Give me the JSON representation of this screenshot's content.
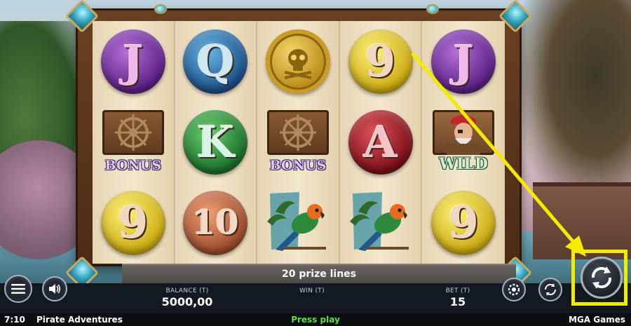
{
  "game": {
    "title": "Pirate Adventures",
    "provider": "MGA Games",
    "clock": "7:10",
    "status_message": "Press play"
  },
  "reels": [
    [
      {
        "type": "letter",
        "glyph": "J",
        "color": "purple"
      },
      {
        "type": "bonus",
        "label": "BONUS",
        "icon": "ship-wheel-icon"
      },
      {
        "type": "letter",
        "glyph": "9",
        "color": "yellow"
      }
    ],
    [
      {
        "type": "letter",
        "glyph": "Q",
        "color": "blue"
      },
      {
        "type": "letter",
        "glyph": "K",
        "color": "green"
      },
      {
        "type": "letter",
        "glyph": "10",
        "color": "copper"
      }
    ],
    [
      {
        "type": "skull-coin",
        "icon": "skull-coin-icon"
      },
      {
        "type": "bonus",
        "label": "BONUS",
        "icon": "ship-wheel-icon"
      },
      {
        "type": "parrot",
        "icon": "parrot-icon"
      }
    ],
    [
      {
        "type": "letter",
        "glyph": "9",
        "color": "yellow"
      },
      {
        "type": "letter",
        "glyph": "A",
        "color": "red"
      },
      {
        "type": "parrot",
        "icon": "parrot-icon"
      }
    ],
    [
      {
        "type": "letter",
        "glyph": "J",
        "color": "purple"
      },
      {
        "type": "wild",
        "label": "WILD",
        "icon": "pirate-captain-icon"
      },
      {
        "type": "letter",
        "glyph": "9",
        "color": "yellow"
      }
    ]
  ],
  "prize_lines": "20 prize lines",
  "stats": {
    "balance_label": "BALANCE (T)",
    "balance_value": "5000,00",
    "win_label": "WIN (T)",
    "bet_label": "BET (T)",
    "bet_value": "15"
  },
  "buttons": {
    "menu": "menu-icon",
    "sound": "speaker-icon",
    "autoplay": "autoplay-icon",
    "turbo": "turbo-icon",
    "spin": "spin-icon"
  },
  "highlight_color": "#f4ea00"
}
